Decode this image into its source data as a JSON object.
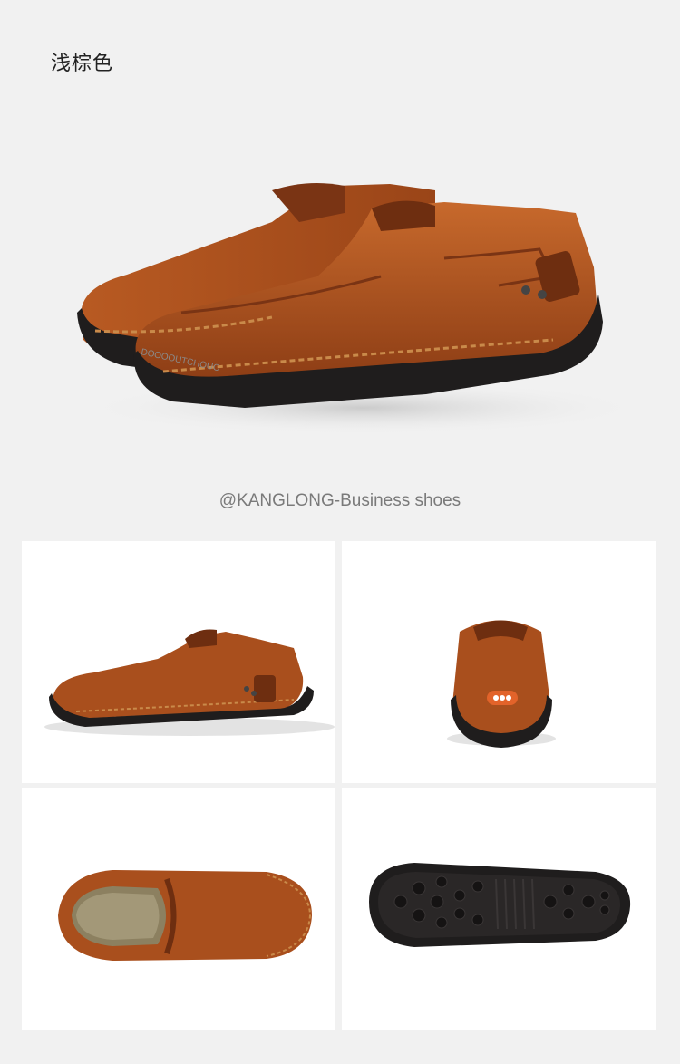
{
  "product": {
    "color_name": "浅棕色",
    "caption": "@KANGLONG-Business shoes",
    "sole_brand_text": "DOOOOUTCHOUC"
  },
  "colors": {
    "leather": "#a34e1d",
    "leather_light": "#c2672b",
    "leather_dark": "#6e2e10",
    "sole": "#1f1d1d",
    "stitch": "#c98a4a",
    "background": "#f1f1f1",
    "tile": "#ffffff"
  },
  "views": [
    {
      "id": "side",
      "icon": "shoe-side-view"
    },
    {
      "id": "back",
      "icon": "shoe-back-view"
    },
    {
      "id": "top",
      "icon": "shoe-top-view"
    },
    {
      "id": "sole",
      "icon": "shoe-sole-view"
    }
  ]
}
